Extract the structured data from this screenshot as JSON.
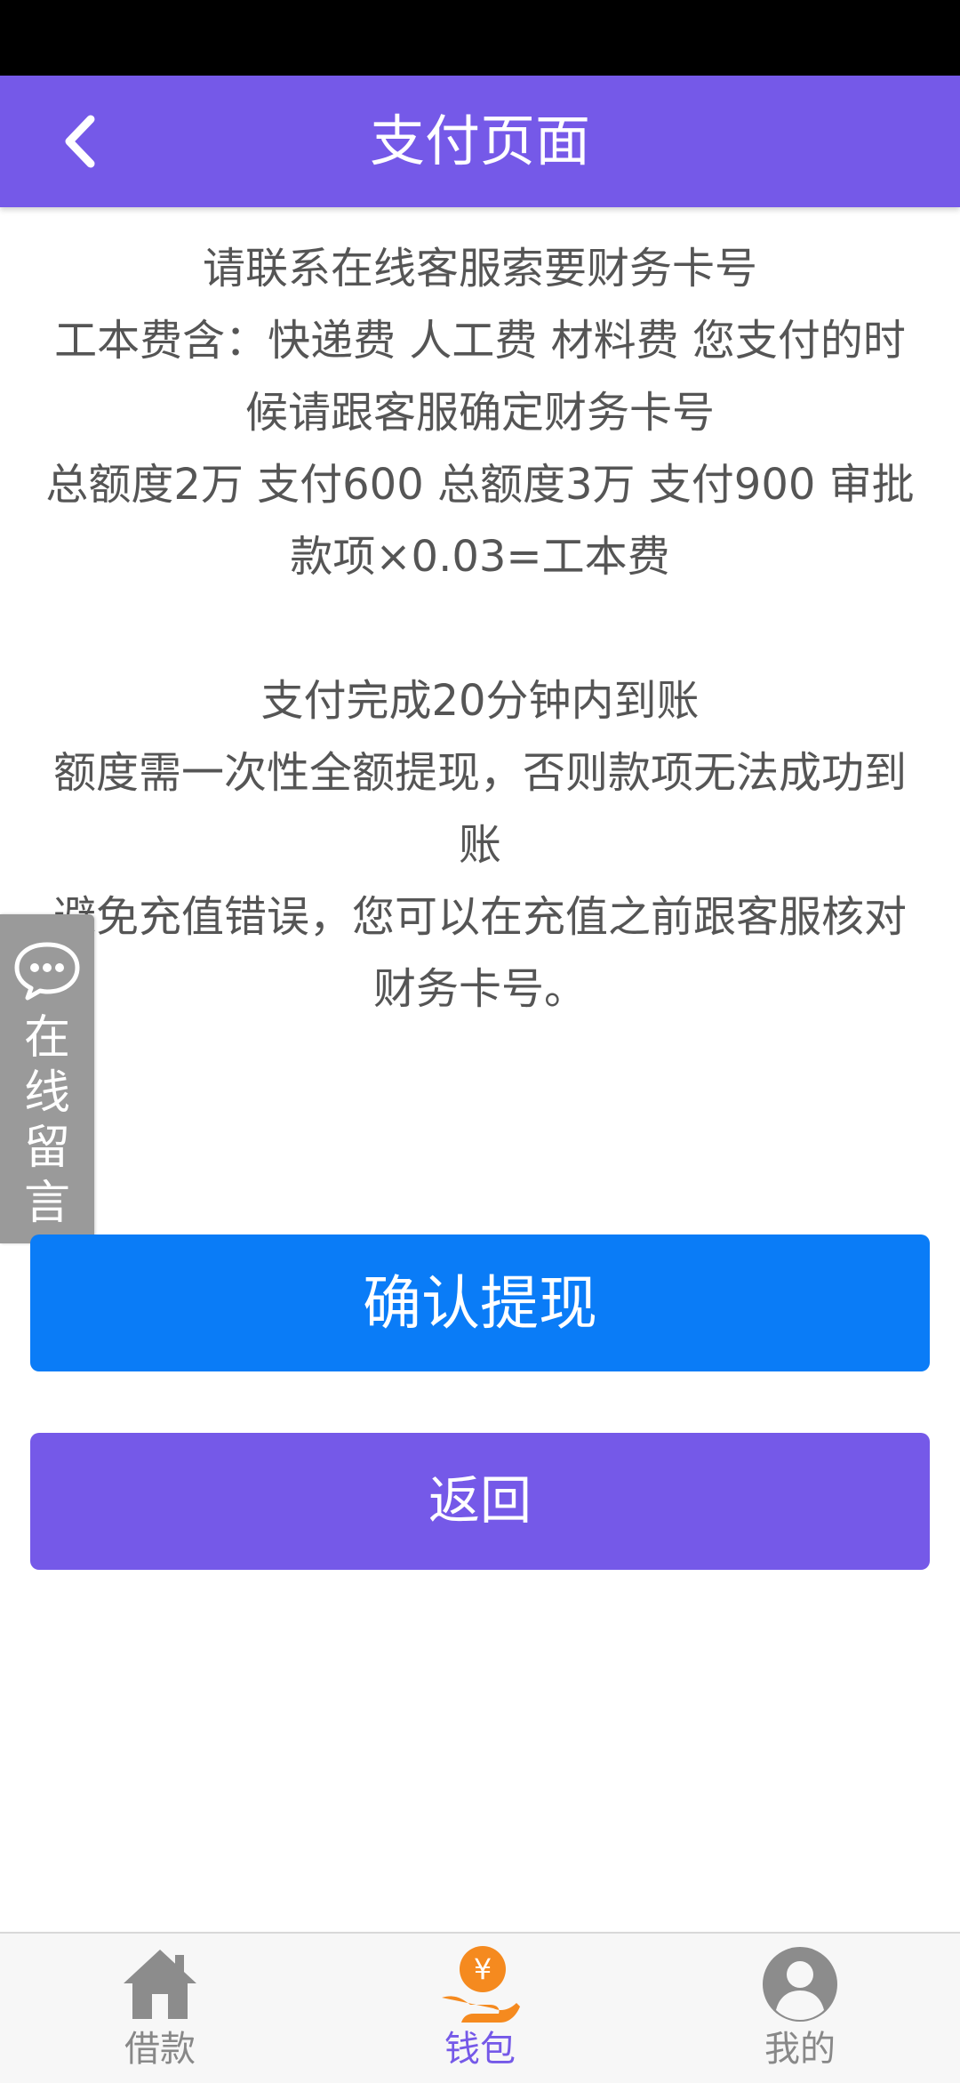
{
  "colors": {
    "accent": "#7559E8",
    "primary": "#0A7CF7",
    "tab_orange": "#F58A1F",
    "tab_gray": "#8C8C8C"
  },
  "header": {
    "title": "支付页面",
    "back_icon": "chevron-left-icon"
  },
  "content": {
    "paragraphs": [
      "请联系在线客服索要财务卡号",
      "工本费含：快递费 人工费 材料费 您支付的时候请跟客服确定财务卡号",
      "总额度2万 支付600  总额度3万 支付900 审批款项×0.03=工本费",
      "支付完成20分钟内到账",
      "额度需一次性全额提现，否则款项无法成功到账",
      "避免充值错误，您可以在充值之前跟客服核对财务卡号。"
    ]
  },
  "float_tab": {
    "icon": "chat-bubble-icon",
    "label": "在线留言"
  },
  "buttons": {
    "confirm_label": "确认提现",
    "back_label": "返回"
  },
  "tabbar": {
    "items": [
      {
        "label": "借款",
        "icon": "house-icon",
        "active": false
      },
      {
        "label": "钱包",
        "icon": "wallet-yen-icon",
        "active": true
      },
      {
        "label": "我的",
        "icon": "user-avatar-icon",
        "active": false
      }
    ]
  }
}
